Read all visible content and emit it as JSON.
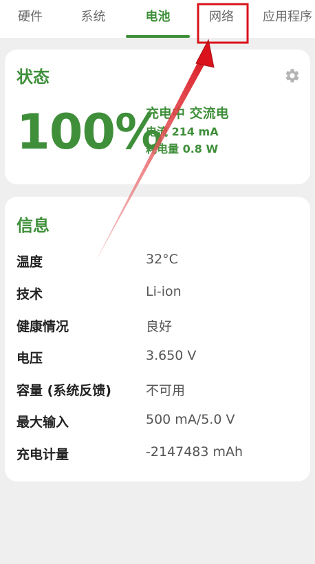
{
  "tabs": [
    {
      "label": "硬件"
    },
    {
      "label": "系统"
    },
    {
      "label": "电池"
    },
    {
      "label": "网络"
    },
    {
      "label": "应用程序"
    }
  ],
  "status": {
    "title": "状态",
    "percent": "100%",
    "charging": "充电中 交流电",
    "current": "电流 214 mA",
    "power": "耗电量 0.8 W"
  },
  "info": {
    "title": "信息",
    "rows": [
      {
        "label": "温度",
        "value": "32°C"
      },
      {
        "label": "技术",
        "value": "Li-ion"
      },
      {
        "label": "健康情况",
        "value": "良好"
      },
      {
        "label": "电压",
        "value": "3.650 V"
      },
      {
        "label": "容量 (系统反馈)",
        "value": "不可用"
      },
      {
        "label": "最大输入",
        "value": "500 mA/5.0 V"
      },
      {
        "label": "充电计量",
        "value": "-2147483 mAh"
      }
    ]
  },
  "icons": {
    "settings": "gear-icon"
  },
  "colors": {
    "accent": "#3f8f3a",
    "highlight": "#d9121b",
    "background": "#efefef"
  }
}
